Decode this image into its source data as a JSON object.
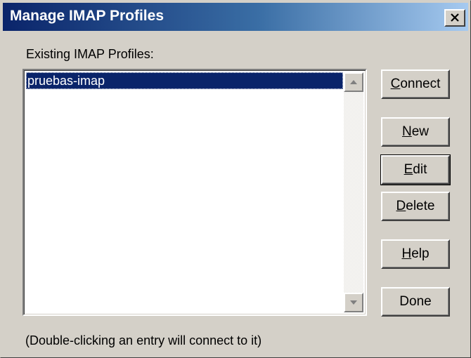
{
  "window": {
    "title": "Manage IMAP Profiles",
    "close_symbol": "close-icon"
  },
  "profiles": {
    "label": "Existing IMAP Profiles:",
    "items": [
      "pruebas-imap"
    ],
    "selected_index": 0
  },
  "buttons": {
    "connect": {
      "mnemonic": "C",
      "rest": "onnect"
    },
    "new": {
      "mnemonic": "N",
      "rest": "ew"
    },
    "edit": {
      "mnemonic": "E",
      "rest": "dit"
    },
    "delete": {
      "mnemonic": "D",
      "rest": "elete"
    },
    "help": {
      "mnemonic": "H",
      "rest": "elp"
    },
    "done": {
      "label": "Done"
    }
  },
  "hint": "(Double-clicking an entry will connect to it)",
  "colors": {
    "titlebar_start": "#0a246a",
    "titlebar_end": "#a6caf0",
    "face": "#d4d0c8",
    "selection": "#0a246a"
  }
}
